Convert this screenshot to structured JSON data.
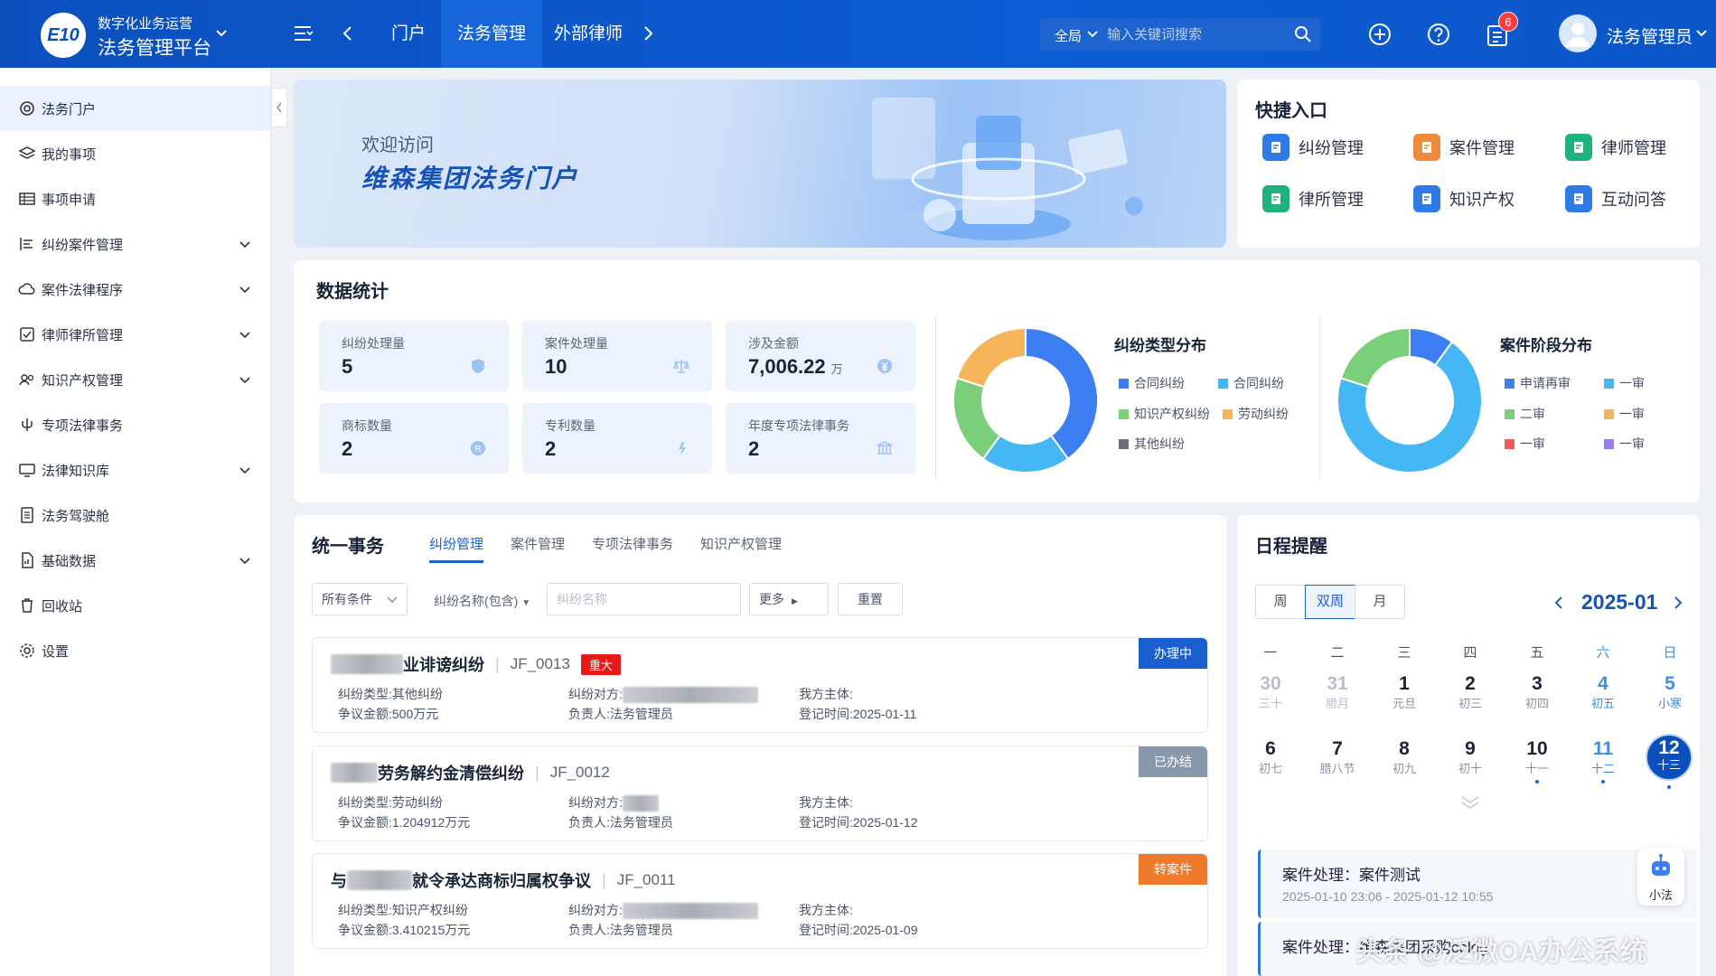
{
  "header": {
    "logo_text": "E10",
    "brand_line1": "数字化业务运营",
    "brand_line2": "法务管理平台",
    "nav": [
      "门户",
      "法务管理",
      "外部律师"
    ],
    "active_nav": "法务管理",
    "search_scope": "全局",
    "search_placeholder": "输入关键词搜索",
    "notification_count": "6",
    "user_name": "法务管理员"
  },
  "sidebar": {
    "items": [
      {
        "label": "法务门户",
        "icon": "at-icon",
        "expandable": false
      },
      {
        "label": "我的事项",
        "icon": "layers-icon",
        "expandable": false
      },
      {
        "label": "事项申请",
        "icon": "table-icon",
        "expandable": false
      },
      {
        "label": "纠纷案件管理",
        "icon": "list-icon",
        "expandable": true
      },
      {
        "label": "案件法律程序",
        "icon": "cloud-icon",
        "expandable": true
      },
      {
        "label": "律师律所管理",
        "icon": "checkbox-icon",
        "expandable": true
      },
      {
        "label": "知识产权管理",
        "icon": "users-icon",
        "expandable": true
      },
      {
        "label": "专项法律事务",
        "icon": "branch-icon",
        "expandable": false
      },
      {
        "label": "法律知识库",
        "icon": "monitor-icon",
        "expandable": true
      },
      {
        "label": "法务驾驶舱",
        "icon": "document-icon",
        "expandable": false
      },
      {
        "label": "基础数据",
        "icon": "file-chart-icon",
        "expandable": true
      },
      {
        "label": "回收站",
        "icon": "trash-icon",
        "expandable": false
      },
      {
        "label": "设置",
        "icon": "gear-icon",
        "expandable": false
      }
    ]
  },
  "banner": {
    "line1": "欢迎访问",
    "line2": "维森集团法务门户"
  },
  "quick": {
    "title": "快捷入口",
    "items": [
      {
        "label": "纠纷管理",
        "color": "#2f7be6"
      },
      {
        "label": "案件管理",
        "color": "#f08a3c"
      },
      {
        "label": "律师管理",
        "color": "#1fb27a"
      },
      {
        "label": "律所管理",
        "color": "#1fb27a"
      },
      {
        "label": "知识产权",
        "color": "#2f7be6"
      },
      {
        "label": "互动问答",
        "color": "#2f7be6"
      }
    ]
  },
  "stats": {
    "title": "数据统计",
    "cards": [
      {
        "label": "纠纷处理量",
        "value": "5",
        "unit": ""
      },
      {
        "label": "案件处理量",
        "value": "10",
        "unit": ""
      },
      {
        "label": "涉及金额",
        "value": "7,006.22",
        "unit": "万"
      },
      {
        "label": "商标数量",
        "value": "2",
        "unit": ""
      },
      {
        "label": "专利数量",
        "value": "2",
        "unit": ""
      },
      {
        "label": "年度专项法律事务",
        "value": "2",
        "unit": ""
      }
    ]
  },
  "chart_data": [
    {
      "type": "pie",
      "title": "纠纷类型分布",
      "categories": [
        "合同纠纷",
        "合同纠纷",
        "知识产权纠纷",
        "劳动纠纷",
        "其他纠纷"
      ],
      "values": [
        40,
        20,
        20,
        20,
        0
      ],
      "colors": [
        "#3d7ff2",
        "#45b7f5",
        "#7bcf7b",
        "#f7b55a",
        "#6b6f78"
      ]
    },
    {
      "type": "pie",
      "title": "案件阶段分布",
      "categories": [
        "申请再审",
        "一审",
        "二审",
        "一审",
        "一审",
        "一审"
      ],
      "values": [
        10,
        70,
        20,
        0,
        0,
        0
      ],
      "colors": [
        "#3d7ff2",
        "#45b7f5",
        "#7bcf7b",
        "#f7b55a",
        "#f25b5b",
        "#9a7bf2"
      ]
    }
  ],
  "affairs": {
    "title": "统一事务",
    "tabs": [
      "纠纷管理",
      "案件管理",
      "专项法律事务",
      "知识产权管理"
    ],
    "filter_conditions": "所有条件",
    "filter_field": "纠纷名称(包含)",
    "filter_placeholder": "纠纷名称",
    "more_label": "更多",
    "reset_label": "重置",
    "items": [
      {
        "title_visible": "业诽谤纠纷",
        "code": "JF_0013",
        "tag": "重大",
        "status": "办理中",
        "status_color": "#1a5fd0",
        "type_label": "纠纷类型:",
        "type": "其他纠纷",
        "amount_label": "争议金额:",
        "amount": "500万元",
        "party_label": "纠纷对方:",
        "owner_label": "负责人:",
        "owner": "法务管理员",
        "entity_label": "我方主体:",
        "date_label": "登记时间:",
        "date": "2025-01-11"
      },
      {
        "title_visible": "劳务解约金清偿纠纷",
        "code": "JF_0012",
        "tag": "",
        "status": "已办结",
        "status_color": "#8a98ad",
        "type_label": "纠纷类型:",
        "type": "劳动纠纷",
        "amount_label": "争议金额:",
        "amount": "1.204912万元",
        "party_label": "纠纷对方:",
        "owner_label": "负责人:",
        "owner": "法务管理员",
        "entity_label": "我方主体:",
        "date_label": "登记时间:",
        "date": "2025-01-12"
      },
      {
        "title_prefix": "与",
        "title_visible": "就令承达商标归属权争议",
        "code": "JF_0011",
        "tag": "",
        "status": "转案件",
        "status_color": "#f07a2c",
        "type_label": "纠纷类型:",
        "type": "知识产权纠纷",
        "amount_label": "争议金额:",
        "amount": "3.410215万元",
        "party_label": "纠纷对方:",
        "owner_label": "负责人:",
        "owner": "法务管理员",
        "entity_label": "我方主体:",
        "date_label": "登记时间:",
        "date": "2025-01-09"
      }
    ]
  },
  "schedule": {
    "title": "日程提醒",
    "views": [
      "周",
      "双周",
      "月"
    ],
    "active_view": "双周",
    "month": "2025-01",
    "weekdays": [
      "一",
      "二",
      "三",
      "四",
      "五",
      "六",
      "日"
    ],
    "days": [
      {
        "n": "30",
        "l": "三十",
        "dim": true
      },
      {
        "n": "31",
        "l": "腊月",
        "dim": true
      },
      {
        "n": "1",
        "l": "元旦"
      },
      {
        "n": "2",
        "l": "初三"
      },
      {
        "n": "3",
        "l": "初四"
      },
      {
        "n": "4",
        "l": "初五",
        "wk": true
      },
      {
        "n": "5",
        "l": "小寒",
        "wk": true
      },
      {
        "n": "6",
        "l": "初七"
      },
      {
        "n": "7",
        "l": "腊八节"
      },
      {
        "n": "8",
        "l": "初九"
      },
      {
        "n": "9",
        "l": "初十"
      },
      {
        "n": "10",
        "l": "十一",
        "dot": true
      },
      {
        "n": "11",
        "l": "十二",
        "wk": true,
        "dot": true
      },
      {
        "n": "12",
        "l": "十三",
        "today": true,
        "dot": true
      }
    ],
    "events": [
      {
        "title": "案件处理：案件测试",
        "time": "2025-01-10 23:06 - 2025-01-12 10:55"
      },
      {
        "title": "案件处理：维森集团采购colog",
        "time": ""
      }
    ],
    "assistant_label": "小法"
  },
  "watermark": "头条 @泛微OA办公系统"
}
